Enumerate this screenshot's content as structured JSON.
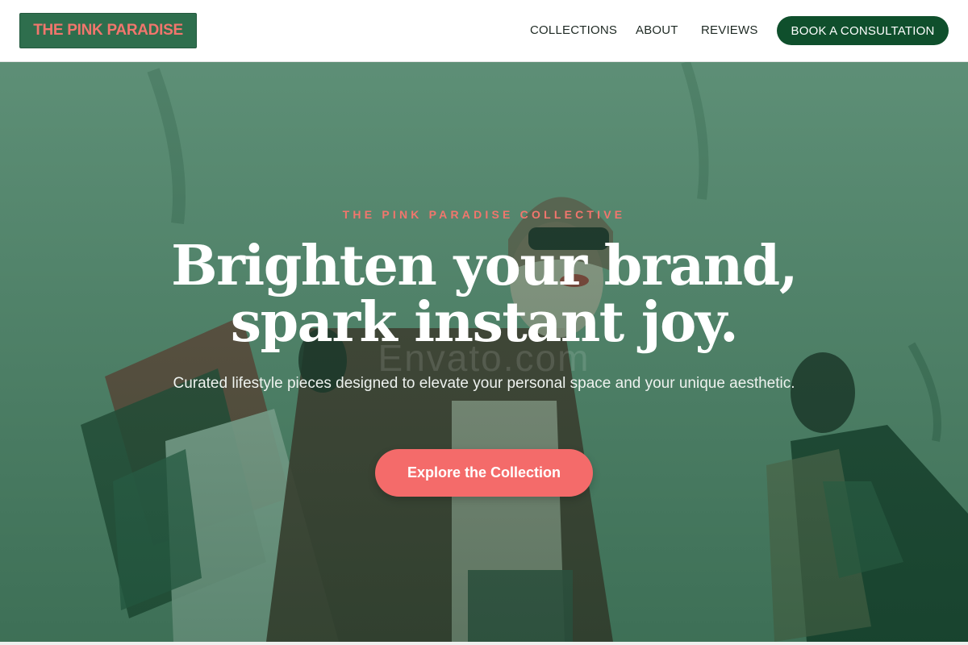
{
  "header": {
    "logo": "THE PINK PARADISE",
    "nav": {
      "collections": "COLLECTIONS",
      "about": "ABOUT",
      "reviews": "REVIEWS"
    },
    "cta": "BOOK A CONSULTATION"
  },
  "hero": {
    "eyebrow": "THE PINK PARADISE COLLECTIVE",
    "headline_line1": "Brighten your brand,",
    "headline_line2": "spark instant joy.",
    "subhead": "Curated lifestyle pieces designed to elevate your personal space and your unique aesthetic.",
    "cta": "Explore the Collection",
    "watermark": "Envato.com"
  },
  "colors": {
    "logo_bg": "#2e6e4d",
    "logo_text": "#f2766d",
    "header_cta_bg": "#0f4f2c",
    "hero_overlay": "#3f7a5c",
    "accent_coral": "#f46b6a"
  }
}
